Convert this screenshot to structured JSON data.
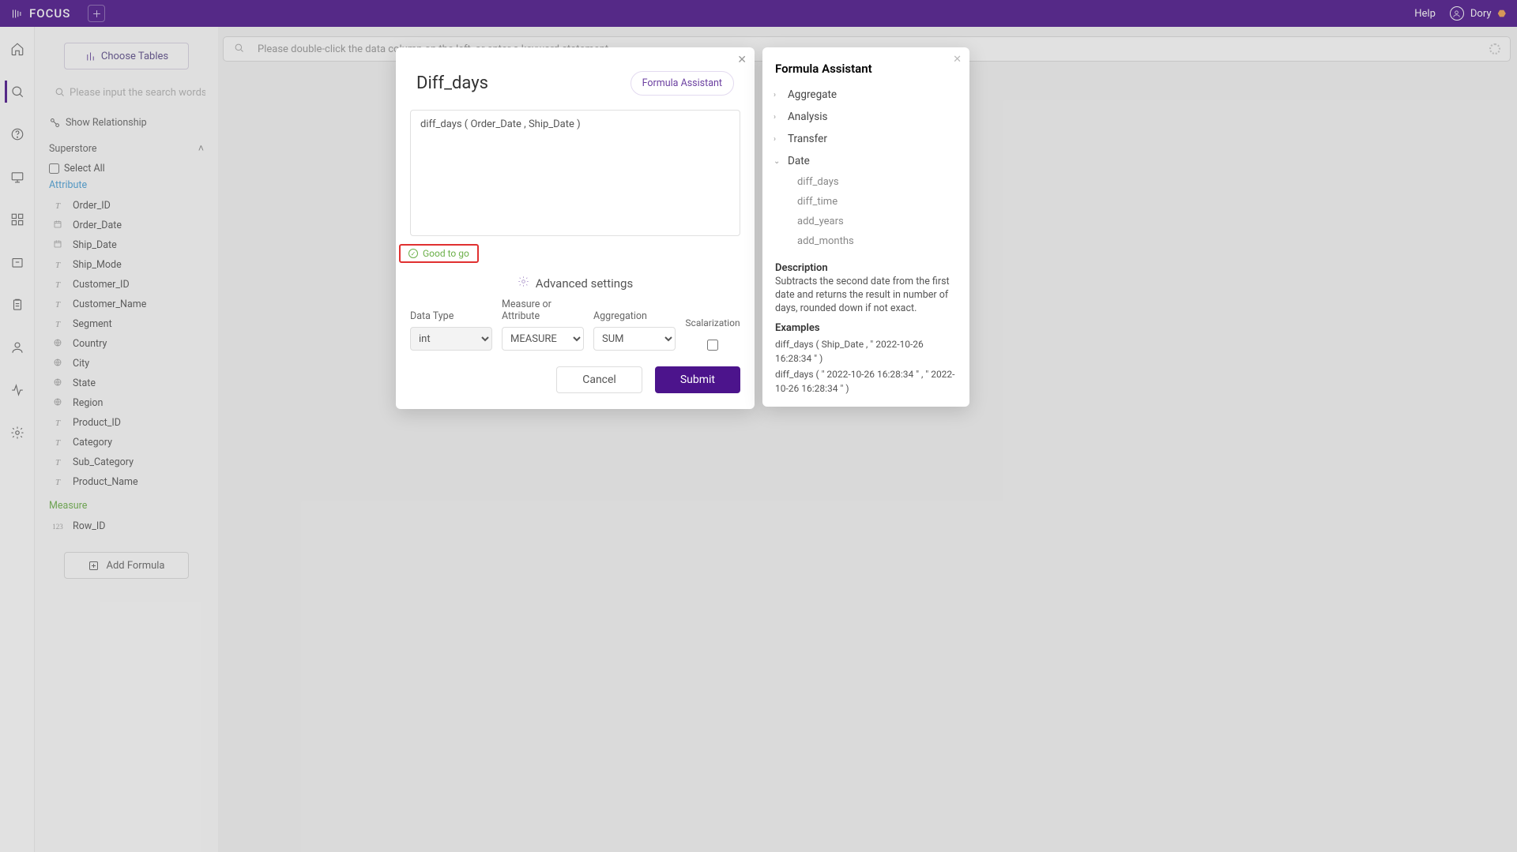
{
  "top": {
    "brand": "FOCUS",
    "help": "Help",
    "user": "Dory"
  },
  "sidebar": {
    "choose": "Choose Tables",
    "search_placeholder": "Please input the search words",
    "show_rel": "Show Relationship",
    "datasource": "Superstore",
    "select_all": "Select All",
    "attr_label": "Attribute",
    "meas_label": "Measure",
    "attrs": [
      {
        "t": "T",
        "n": "Order_ID"
      },
      {
        "t": "D",
        "n": "Order_Date"
      },
      {
        "t": "D",
        "n": "Ship_Date"
      },
      {
        "t": "T",
        "n": "Ship_Mode"
      },
      {
        "t": "T",
        "n": "Customer_ID"
      },
      {
        "t": "T",
        "n": "Customer_Name"
      },
      {
        "t": "T",
        "n": "Segment"
      },
      {
        "t": "G",
        "n": "Country"
      },
      {
        "t": "G",
        "n": "City"
      },
      {
        "t": "G",
        "n": "State"
      },
      {
        "t": "G",
        "n": "Region"
      },
      {
        "t": "T",
        "n": "Product_ID"
      },
      {
        "t": "T",
        "n": "Category"
      },
      {
        "t": "T",
        "n": "Sub_Category"
      },
      {
        "t": "T",
        "n": "Product_Name"
      }
    ],
    "meas": [
      {
        "t": "123",
        "n": "Row_ID"
      }
    ],
    "add_formula": "Add Formula"
  },
  "mainsearch": {
    "placeholder": "Please double-click the data column on the left, or enter a keyword statement"
  },
  "dialog": {
    "title": "Diff_days",
    "fa_btn": "Formula Assistant",
    "expr": "diff_days ( Order_Date , Ship_Date )",
    "status": "Good to go",
    "adv_title": "Advanced settings",
    "dt_label": "Data Type",
    "dt_value": "int",
    "ma_label": "Measure or Attribute",
    "ma_value": "MEASURE",
    "agg_label": "Aggregation",
    "agg_value": "SUM",
    "scal_label": "Scalarization",
    "cancel": "Cancel",
    "submit": "Submit"
  },
  "assist": {
    "title": "Formula Assistant",
    "cats": [
      "Aggregate",
      "Analysis",
      "Transfer",
      "Date"
    ],
    "fns": [
      "diff_days",
      "diff_time",
      "add_years",
      "add_months"
    ],
    "desc_h": "Description",
    "desc": "Subtracts the second date from the first date and returns the result in number of days, rounded down if not exact.",
    "ex_h": "Examples",
    "ex1": "diff_days   (   Ship_Date   ,   \" 2022-10-26   16:28:34 \"   )",
    "ex2": "diff_days   (   \" 2022-10-26   16:28:34 \"   ,   \" 2022-10-26   16:28:34 \"   )"
  }
}
